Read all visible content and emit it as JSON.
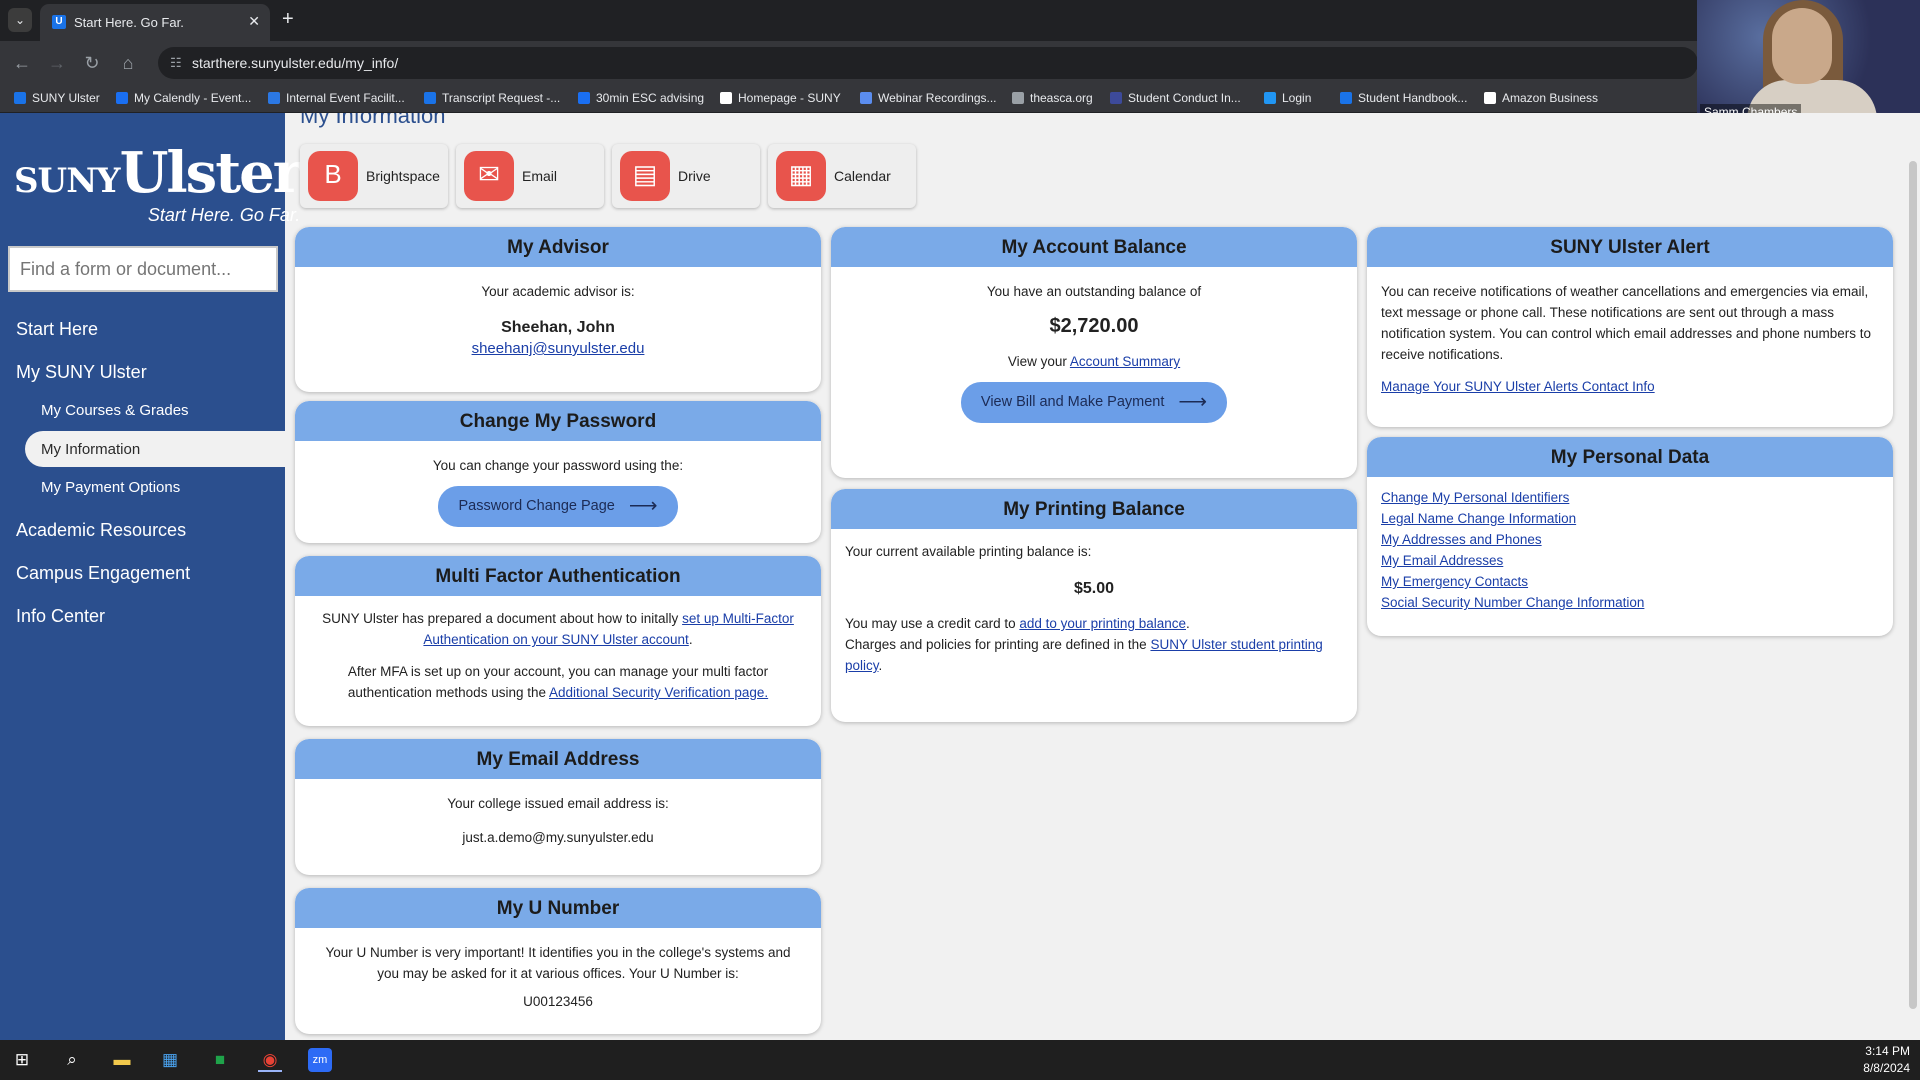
{
  "browser": {
    "tab_title": "Start Here. Go Far.",
    "tab_close": "✕",
    "new_tab": "+",
    "url": "starthere.sunyulster.edu/my_info/",
    "bookmarks": [
      {
        "label": "SUNY Ulster",
        "color": "#1a73e8"
      },
      {
        "label": "My Calendly - Event...",
        "color": "#1a6ff2"
      },
      {
        "label": "Internal Event Facilit...",
        "color": "#2b78e4"
      },
      {
        "label": "Transcript Request -...",
        "color": "#1a73e8"
      },
      {
        "label": "30min ESC advising",
        "color": "#1a6ff2"
      },
      {
        "label": "Homepage - SUNY",
        "color": "#ffffff"
      },
      {
        "label": "Webinar Recordings...",
        "color": "#5b8def"
      },
      {
        "label": "theasca.org",
        "color": "#9aa0a6"
      },
      {
        "label": "Student Conduct In...",
        "color": "#3d4a9a"
      },
      {
        "label": "Login",
        "color": "#2196f3"
      },
      {
        "label": "Student Handbook...",
        "color": "#1a73e8"
      },
      {
        "label": "Amazon Business",
        "color": "#ffffff"
      }
    ]
  },
  "webcam": {
    "name": "Samm Chambers"
  },
  "sidebar": {
    "logo_main": "SUNY",
    "logo_name": "Ulster",
    "logo_tagline": "Start Here. Go Far.",
    "search_placeholder": "Find a form or document...",
    "nav": {
      "start_here": "Start Here",
      "my_suny_ulster": "My SUNY Ulster",
      "courses": "My Courses & Grades",
      "information": "My Information",
      "payment": "My Payment Options",
      "academic": "Academic Resources",
      "campus": "Campus Engagement",
      "info_center": "Info Center"
    }
  },
  "page": {
    "heading": "My Information",
    "apps": [
      {
        "label": "Brightspace",
        "icon": "B"
      },
      {
        "label": "Email",
        "icon": "✉"
      },
      {
        "label": "Drive",
        "icon": "▤"
      },
      {
        "label": "Calendar",
        "icon": "▦"
      }
    ]
  },
  "advisor": {
    "title": "My Advisor",
    "intro": "Your academic advisor is:",
    "name": "Sheehan, John",
    "email": "sheehanj@sunyulster.edu"
  },
  "password": {
    "title": "Change My Password",
    "intro": "You can change your password using the:",
    "button": "Password Change Page"
  },
  "mfa": {
    "title": "Multi Factor Authentication",
    "p1_pre": "SUNY Ulster has prepared a document about how to initally",
    "p1_link": "set up Multi-Factor Authentication on your SUNY Ulster account",
    "p1_post": ".",
    "p2_pre": "After MFA is set up on your account, you can manage your multi factor authentication methods using the",
    "p2_link": "Additional Security Verification page."
  },
  "email_card": {
    "title": "My Email Address",
    "intro": "Your college issued email address is:",
    "address": "just.a.demo@my.sunyulster.edu"
  },
  "u_number": {
    "title": "My U Number",
    "intro": "Your U Number is very important! It identifies you in the college's systems and you may be asked for it at various offices. Your U Number is:",
    "value": "U00123456"
  },
  "balance": {
    "title": "My Account Balance",
    "intro": "You have an outstanding balance of",
    "amount": "$2,720.00",
    "view_pre": "View your",
    "view_link": "Account Summary",
    "button": "View Bill and Make Payment"
  },
  "printing": {
    "title": "My Printing Balance",
    "intro": "Your current available printing balance is:",
    "amount": "$5.00",
    "p1_pre": "You may use a credit card to",
    "p1_link": "add to your printing balance",
    "p1_post": ".",
    "p2_pre": "Charges and policies for printing are defined in the",
    "p2_link": "SUNY Ulster student printing policy",
    "p2_post": "."
  },
  "alert": {
    "title": "SUNY Ulster Alert",
    "body": "You can receive notifications of weather cancellations and emergencies via email, text message or phone call. These notifications are sent out through a mass notification system. You can control which email addresses and phone numbers to receive notifications.",
    "link": "Manage Your SUNY Ulster Alerts Contact Info"
  },
  "personal": {
    "title": "My Personal Data",
    "links": [
      "Change My Personal Identifiers",
      "Legal Name Change Information",
      "My Addresses and Phones",
      "My Email Addresses",
      "My Emergency Contacts",
      "Social Security Number Change Information"
    ]
  },
  "taskbar": {
    "time": "3:14 PM",
    "date": "8/8/2024"
  }
}
